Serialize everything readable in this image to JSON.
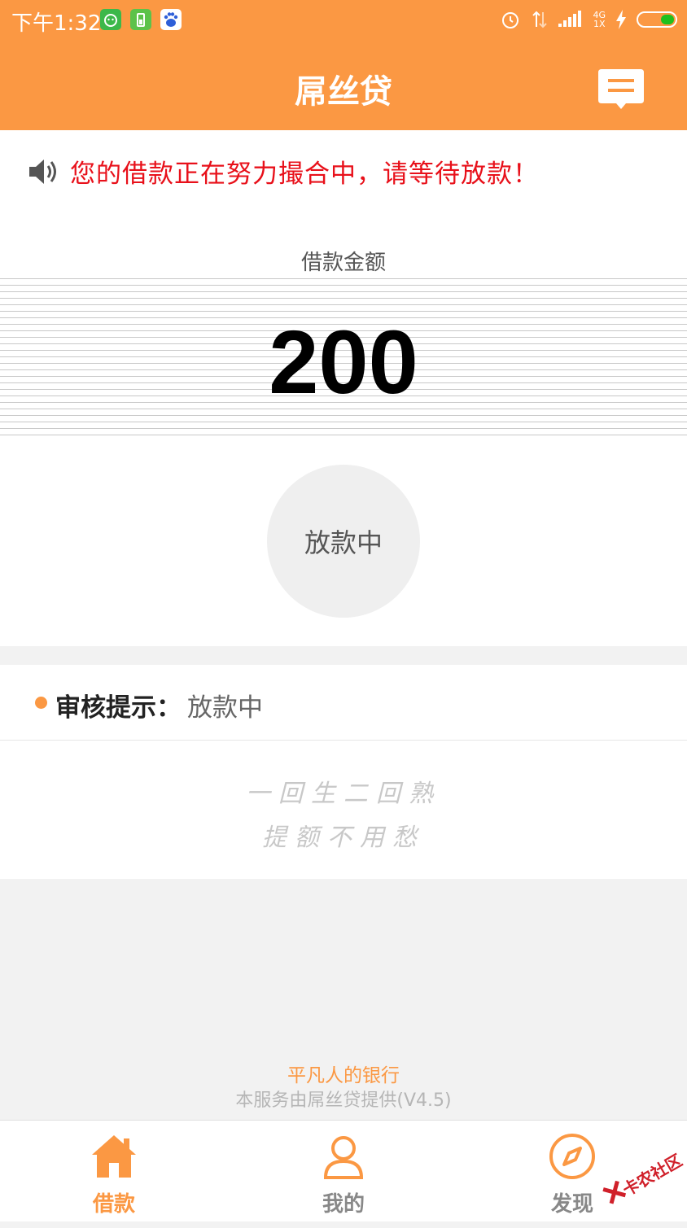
{
  "status_bar": {
    "time": "下午1:32",
    "net_top": "4G",
    "net_bottom": "1X"
  },
  "app_bar": {
    "title": "屌丝贷",
    "message_icon": "message-icon"
  },
  "colors": {
    "primary": "#fb9843",
    "notice": "#e8101a",
    "battery": "#1ec01e"
  },
  "notice": {
    "icon": "speaker-icon",
    "text": "您的借款正在努力撮合中，请等待放款！"
  },
  "loan": {
    "amount_label": "借款金额",
    "amount": "200",
    "status": "放款中"
  },
  "review": {
    "label": "审核提示：",
    "value": "放款中"
  },
  "slogan": {
    "line1": "一回生二回熟",
    "line2": "提额不用愁"
  },
  "footer": {
    "tagline": "平凡人的银行",
    "service": "本服务由屌丝贷提供(V4.5)"
  },
  "tabs": [
    {
      "label": "借款",
      "icon": "home-icon",
      "active": true
    },
    {
      "label": "我的",
      "icon": "user-icon",
      "active": false
    },
    {
      "label": "发现",
      "icon": "compass-icon",
      "active": false
    }
  ],
  "watermark": {
    "text": "卡农社区"
  }
}
